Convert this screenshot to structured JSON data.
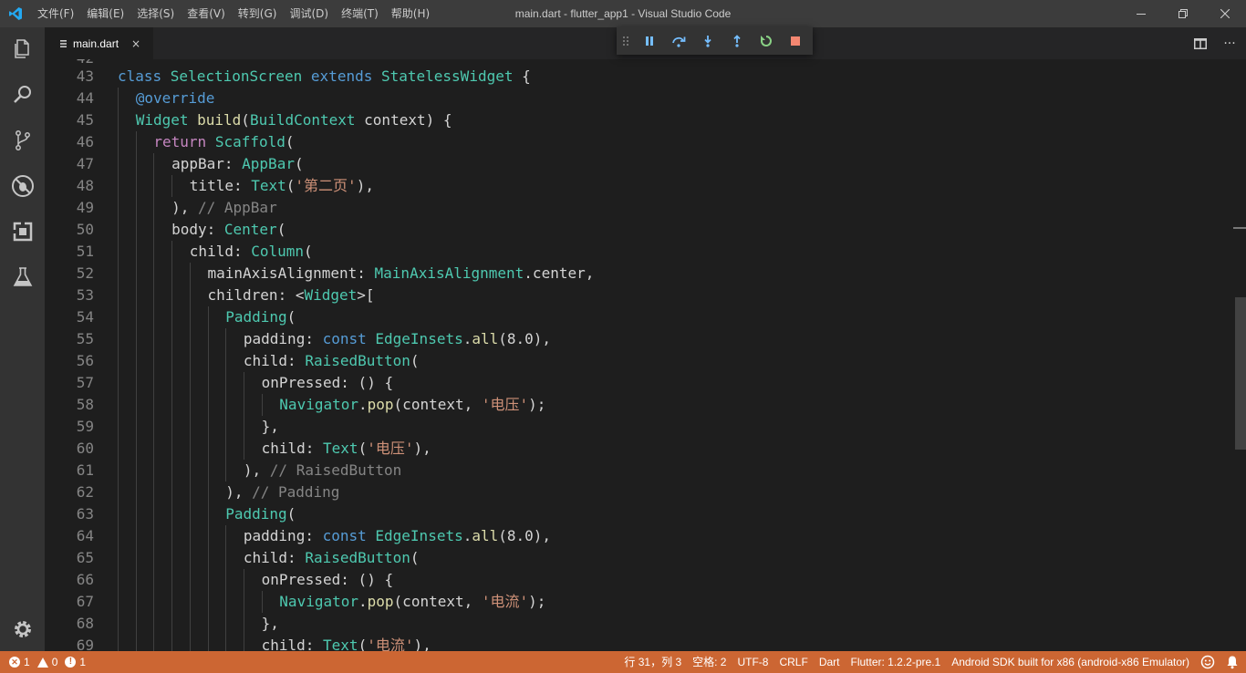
{
  "window": {
    "title": "main.dart - flutter_app1 - Visual Studio Code"
  },
  "menu": [
    {
      "label": "文件(F)"
    },
    {
      "label": "编辑(E)"
    },
    {
      "label": "选择(S)"
    },
    {
      "label": "查看(V)"
    },
    {
      "label": "转到(G)"
    },
    {
      "label": "调试(D)"
    },
    {
      "label": "终端(T)"
    },
    {
      "label": "帮助(H)"
    }
  ],
  "tab": {
    "label": "main.dart",
    "close": "×"
  },
  "statusbar": {
    "errors": "1",
    "warnings": "0",
    "infos": "1",
    "position": "行 31，列 3",
    "indent": "空格: 2",
    "encoding": "UTF-8",
    "eol": "CRLF",
    "language": "Dart",
    "flutter": "Flutter: 1.2.2-pre.1",
    "device": "Android SDK built for x86 (android-x86 Emulator)"
  },
  "colors": {
    "statusbar": "#cc6633",
    "activitybar": "#333333",
    "titlebar": "#3c3c3c",
    "editor": "#1e1e1e"
  },
  "editor": {
    "lines": [
      {
        "n": "43",
        "indent": 0,
        "tokens": [
          {
            "t": "class ",
            "c": "k"
          },
          {
            "t": "SelectionScreen ",
            "c": "c"
          },
          {
            "t": "extends ",
            "c": "k"
          },
          {
            "t": "StatelessWidget",
            "c": "c"
          },
          {
            "t": " {",
            "c": ""
          }
        ]
      },
      {
        "n": "44",
        "indent": 1,
        "tokens": [
          {
            "t": "@override",
            "c": "k"
          }
        ]
      },
      {
        "n": "45",
        "indent": 1,
        "tokens": [
          {
            "t": "Widget ",
            "c": "c"
          },
          {
            "t": "build",
            "c": "fn"
          },
          {
            "t": "(",
            "c": ""
          },
          {
            "t": "BuildContext",
            "c": "c"
          },
          {
            "t": " context) {",
            "c": ""
          }
        ]
      },
      {
        "n": "46",
        "indent": 2,
        "tokens": [
          {
            "t": "return ",
            "c": "kc"
          },
          {
            "t": "Scaffold",
            "c": "c"
          },
          {
            "t": "(",
            "c": ""
          }
        ]
      },
      {
        "n": "47",
        "indent": 3,
        "tokens": [
          {
            "t": "appBar: ",
            "c": ""
          },
          {
            "t": "AppBar",
            "c": "c"
          },
          {
            "t": "(",
            "c": ""
          }
        ]
      },
      {
        "n": "48",
        "indent": 4,
        "tokens": [
          {
            "t": "title: ",
            "c": ""
          },
          {
            "t": "Text",
            "c": "c"
          },
          {
            "t": "(",
            "c": ""
          },
          {
            "t": "'第二页'",
            "c": "s"
          },
          {
            "t": "),",
            "c": ""
          }
        ]
      },
      {
        "n": "49",
        "indent": 3,
        "tokens": [
          {
            "t": "), ",
            "c": ""
          },
          {
            "t": "// AppBar",
            "c": "cmg"
          }
        ]
      },
      {
        "n": "50",
        "indent": 3,
        "tokens": [
          {
            "t": "body: ",
            "c": ""
          },
          {
            "t": "Center",
            "c": "c"
          },
          {
            "t": "(",
            "c": ""
          }
        ]
      },
      {
        "n": "51",
        "indent": 4,
        "tokens": [
          {
            "t": "child: ",
            "c": ""
          },
          {
            "t": "Column",
            "c": "c"
          },
          {
            "t": "(",
            "c": ""
          }
        ]
      },
      {
        "n": "52",
        "indent": 5,
        "tokens": [
          {
            "t": "mainAxisAlignment: ",
            "c": ""
          },
          {
            "t": "MainAxisAlignment",
            "c": "c"
          },
          {
            "t": ".center,",
            "c": ""
          }
        ]
      },
      {
        "n": "53",
        "indent": 5,
        "tokens": [
          {
            "t": "children: <",
            "c": ""
          },
          {
            "t": "Widget",
            "c": "c"
          },
          {
            "t": ">[",
            "c": ""
          }
        ]
      },
      {
        "n": "54",
        "indent": 6,
        "tokens": [
          {
            "t": "Padding",
            "c": "c"
          },
          {
            "t": "(",
            "c": ""
          }
        ]
      },
      {
        "n": "55",
        "indent": 7,
        "tokens": [
          {
            "t": "padding: ",
            "c": ""
          },
          {
            "t": "const ",
            "c": "k"
          },
          {
            "t": "EdgeInsets",
            "c": "c"
          },
          {
            "t": ".",
            "c": ""
          },
          {
            "t": "all",
            "c": "fn"
          },
          {
            "t": "(8.0),",
            "c": ""
          }
        ]
      },
      {
        "n": "56",
        "indent": 7,
        "tokens": [
          {
            "t": "child: ",
            "c": ""
          },
          {
            "t": "RaisedButton",
            "c": "c"
          },
          {
            "t": "(",
            "c": ""
          }
        ]
      },
      {
        "n": "57",
        "indent": 8,
        "tokens": [
          {
            "t": "onPressed: () {",
            "c": ""
          }
        ]
      },
      {
        "n": "58",
        "indent": 9,
        "tokens": [
          {
            "t": "Navigator",
            "c": "c"
          },
          {
            "t": ".",
            "c": ""
          },
          {
            "t": "pop",
            "c": "fn"
          },
          {
            "t": "(context, ",
            "c": ""
          },
          {
            "t": "'电压'",
            "c": "s"
          },
          {
            "t": ");",
            "c": ""
          }
        ]
      },
      {
        "n": "59",
        "indent": 8,
        "tokens": [
          {
            "t": "},",
            "c": ""
          }
        ]
      },
      {
        "n": "60",
        "indent": 8,
        "tokens": [
          {
            "t": "child: ",
            "c": ""
          },
          {
            "t": "Text",
            "c": "c"
          },
          {
            "t": "(",
            "c": ""
          },
          {
            "t": "'电压'",
            "c": "s"
          },
          {
            "t": "),",
            "c": ""
          }
        ]
      },
      {
        "n": "61",
        "indent": 7,
        "tokens": [
          {
            "t": "), ",
            "c": ""
          },
          {
            "t": "// RaisedButton",
            "c": "cmg"
          }
        ]
      },
      {
        "n": "62",
        "indent": 6,
        "tokens": [
          {
            "t": "), ",
            "c": ""
          },
          {
            "t": "// Padding",
            "c": "cmg"
          }
        ]
      },
      {
        "n": "63",
        "indent": 6,
        "tokens": [
          {
            "t": "Padding",
            "c": "c"
          },
          {
            "t": "(",
            "c": ""
          }
        ]
      },
      {
        "n": "64",
        "indent": 7,
        "tokens": [
          {
            "t": "padding: ",
            "c": ""
          },
          {
            "t": "const ",
            "c": "k"
          },
          {
            "t": "EdgeInsets",
            "c": "c"
          },
          {
            "t": ".",
            "c": ""
          },
          {
            "t": "all",
            "c": "fn"
          },
          {
            "t": "(8.0),",
            "c": ""
          }
        ]
      },
      {
        "n": "65",
        "indent": 7,
        "tokens": [
          {
            "t": "child: ",
            "c": ""
          },
          {
            "t": "RaisedButton",
            "c": "c"
          },
          {
            "t": "(",
            "c": ""
          }
        ]
      },
      {
        "n": "66",
        "indent": 8,
        "tokens": [
          {
            "t": "onPressed: () {",
            "c": ""
          }
        ]
      },
      {
        "n": "67",
        "indent": 9,
        "tokens": [
          {
            "t": "Navigator",
            "c": "c"
          },
          {
            "t": ".",
            "c": ""
          },
          {
            "t": "pop",
            "c": "fn"
          },
          {
            "t": "(context, ",
            "c": ""
          },
          {
            "t": "'电流'",
            "c": "s"
          },
          {
            "t": ");",
            "c": ""
          }
        ]
      },
      {
        "n": "68",
        "indent": 8,
        "tokens": [
          {
            "t": "},",
            "c": ""
          }
        ]
      },
      {
        "n": "69",
        "indent": 8,
        "tokens": [
          {
            "t": "child: ",
            "c": ""
          },
          {
            "t": "Text",
            "c": "c"
          },
          {
            "t": "(",
            "c": ""
          },
          {
            "t": "'电流'",
            "c": "s"
          },
          {
            "t": "),",
            "c": ""
          }
        ]
      }
    ]
  }
}
